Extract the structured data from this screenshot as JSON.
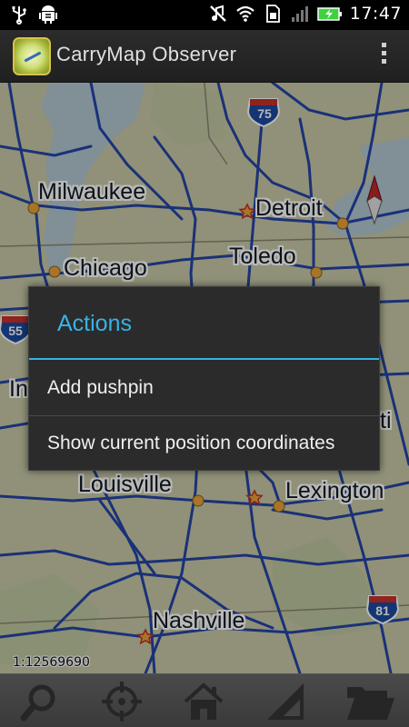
{
  "status_bar": {
    "time": "17:47",
    "icons": [
      "usb-icon",
      "android-debug-icon",
      "mute-icon",
      "wifi-icon",
      "sim-icon",
      "signal-icon",
      "battery-charging-icon"
    ],
    "battery_color": "#3fd13f"
  },
  "action_bar": {
    "title": "CarryMap Observer",
    "icon": "carrymap-app-icon",
    "overflow_icon": "overflow-menu-icon"
  },
  "map": {
    "cities": [
      {
        "name": "Milwaukee"
      },
      {
        "name": "Detroit"
      },
      {
        "name": "Chicago"
      },
      {
        "name": "Toledo"
      },
      {
        "name": "Louisville"
      },
      {
        "name": "Lexington"
      },
      {
        "name": "Nashville"
      }
    ],
    "partial_labels": [
      "In",
      "ti"
    ],
    "shields": [
      {
        "label": "75",
        "type": "interstate"
      },
      {
        "label": "55",
        "type": "interstate"
      },
      {
        "label": "81",
        "type": "interstate"
      }
    ],
    "scale": "1:12569690",
    "compass_icon": "compass-north-icon"
  },
  "dialog": {
    "title": "Actions",
    "items": [
      {
        "label": "Add pushpin"
      },
      {
        "label": "Show current position coordinates"
      }
    ],
    "accent_color": "#33b5e5"
  },
  "toolbar": {
    "buttons": [
      {
        "icon": "search-icon"
      },
      {
        "icon": "locate-crosshair-icon"
      },
      {
        "icon": "home-icon"
      },
      {
        "icon": "measure-ruler-icon"
      },
      {
        "icon": "open-folder-icon"
      }
    ]
  }
}
